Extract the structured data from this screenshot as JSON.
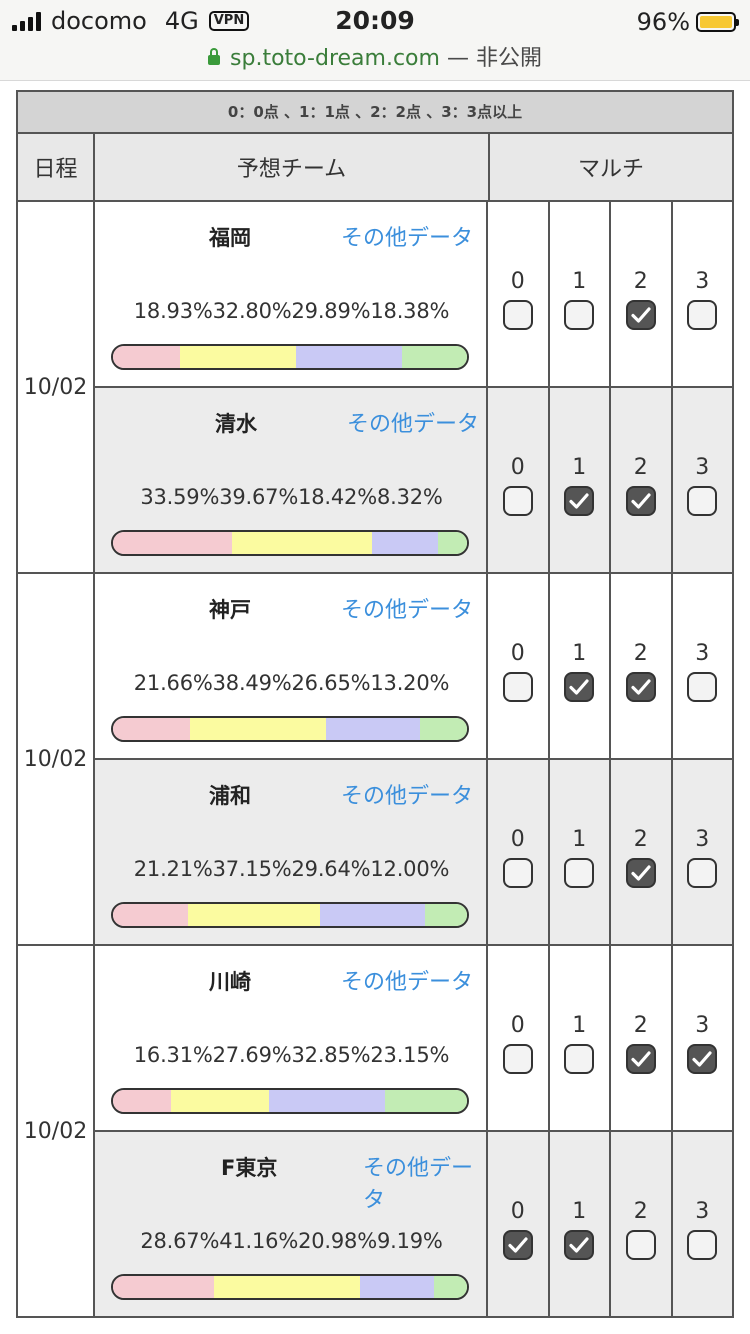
{
  "status_bar": {
    "carrier": "docomo",
    "network": "4G",
    "vpn": "VPN",
    "time": "20:09",
    "battery": "96%"
  },
  "browser": {
    "host": "sp.toto-dream.com",
    "suffix": " — 非公開"
  },
  "legend": "0：0点 、1：1点 、2：2点 、3：3点以上",
  "headers": {
    "date": "日程",
    "team": "予想チーム",
    "multi": "マルチ"
  },
  "other_data_label": "その他データ",
  "matches": [
    {
      "date": "10/02",
      "teams": [
        {
          "name": "福岡",
          "pcts": [
            "18.93%",
            "32.80%",
            "29.89%",
            "18.38%"
          ],
          "checks": [
            false,
            false,
            true,
            false
          ]
        },
        {
          "name": "清水",
          "pcts": [
            "33.59%",
            "39.67%",
            "18.42%",
            "8.32%"
          ],
          "checks": [
            false,
            true,
            true,
            false
          ]
        }
      ]
    },
    {
      "date": "10/02",
      "teams": [
        {
          "name": "神戸",
          "pcts": [
            "21.66%",
            "38.49%",
            "26.65%",
            "13.20%"
          ],
          "checks": [
            false,
            true,
            true,
            false
          ]
        },
        {
          "name": "浦和",
          "pcts": [
            "21.21%",
            "37.15%",
            "29.64%",
            "12.00%"
          ],
          "checks": [
            false,
            false,
            true,
            false
          ]
        }
      ]
    },
    {
      "date": "10/02",
      "teams": [
        {
          "name": "川崎",
          "pcts": [
            "16.31%",
            "27.69%",
            "32.85%",
            "23.15%"
          ],
          "checks": [
            false,
            false,
            true,
            true
          ]
        },
        {
          "name": "F東京",
          "pcts": [
            "28.67%",
            "41.16%",
            "20.98%",
            "9.19%"
          ],
          "checks": [
            true,
            true,
            false,
            false
          ]
        }
      ]
    }
  ],
  "multi_labels": [
    "0",
    "1",
    "2",
    "3"
  ],
  "colors": {
    "score0": "#f5cbd1",
    "score1": "#fbfba0",
    "score2": "#c9c9f5",
    "score3": "#c2ecb4",
    "link": "#3b8fdc"
  }
}
